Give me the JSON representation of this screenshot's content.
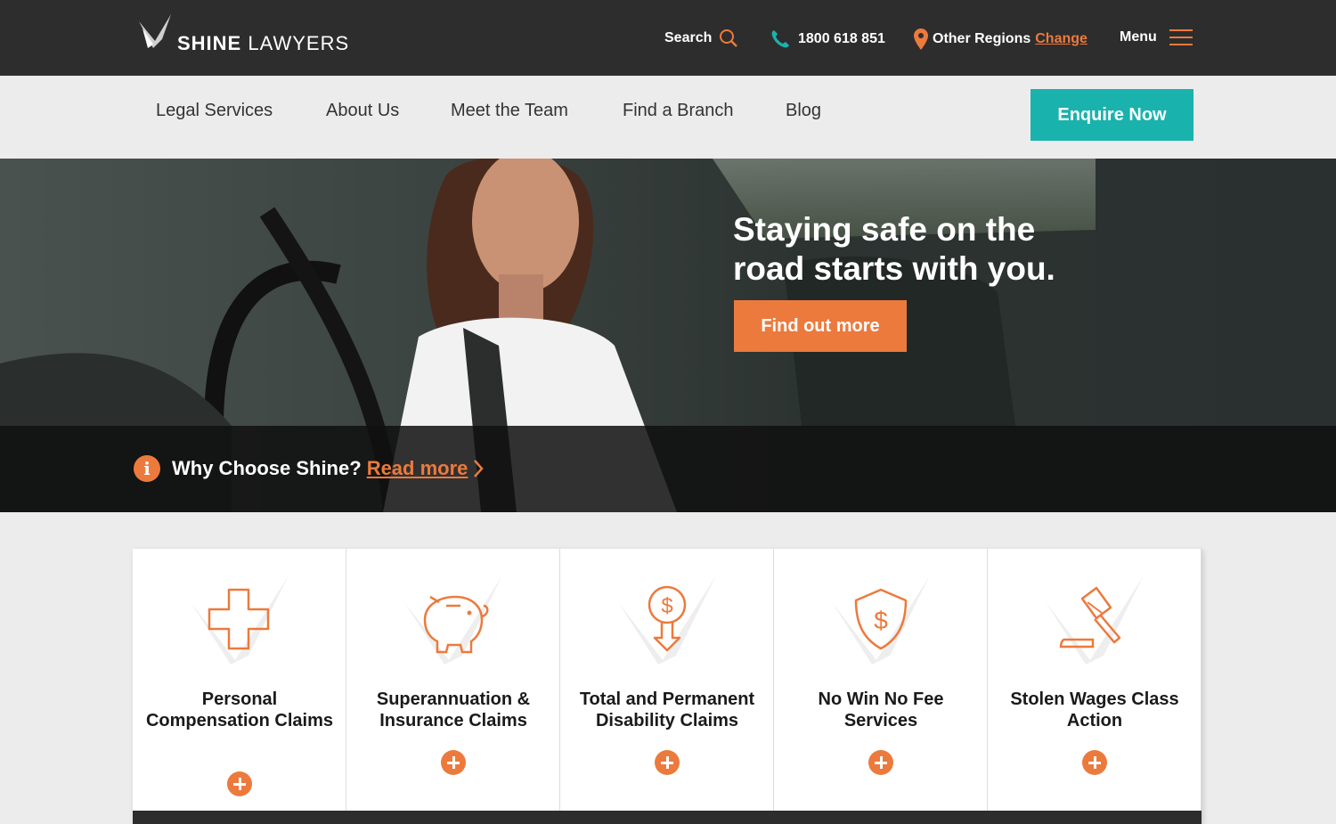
{
  "header": {
    "logo_bold": "SHINE",
    "logo_light": "LAWYERS",
    "search_label": "Search",
    "phone": "1800 618 851",
    "regions_label": "Other Regions",
    "change_label": "Change",
    "menu_label": "Menu"
  },
  "nav": {
    "items": [
      {
        "label": "Legal Services"
      },
      {
        "label": "About Us"
      },
      {
        "label": "Meet the Team"
      },
      {
        "label": "Find a Branch"
      },
      {
        "label": "Blog"
      }
    ],
    "enquire_label": "Enquire Now"
  },
  "hero": {
    "title_line1": "Staying safe on the",
    "title_line2": "road starts with you.",
    "cta_label": "Find out more",
    "why_label": "Why Choose Shine?",
    "read_more_label": "Read more",
    "info_icon": "i"
  },
  "services": [
    {
      "title": "Personal Compensation Claims",
      "icon": "medical-cross-icon"
    },
    {
      "title": "Superannuation & Insurance Claims",
      "icon": "piggy-bank-icon"
    },
    {
      "title": "Total and Permanent Disability Claims",
      "icon": "dollar-down-arrow-icon"
    },
    {
      "title": "No Win No Fee Services",
      "icon": "shield-dollar-icon"
    },
    {
      "title": "Stolen Wages Class Action",
      "icon": "gavel-icon"
    }
  ],
  "colors": {
    "accent_orange": "#ec7a3d",
    "accent_teal": "#1ab2ad",
    "dark": "#2d2d2d"
  }
}
